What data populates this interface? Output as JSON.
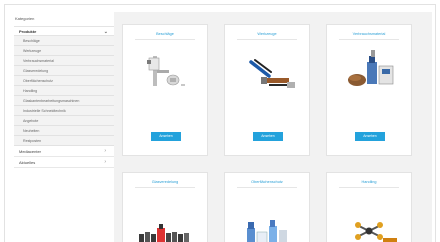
{
  "sidebar": {
    "heading": "Kategorien",
    "section": "Produkte",
    "items": [
      "Beschläge",
      "Werkzeuge",
      "Verbrauchsmaterial",
      "Glasveredelung",
      "Oberflächenschutz",
      "Handling",
      "Glaskantenbearbeitungsmaschinen",
      "Industrielle Schneidtechnik",
      "Angebote",
      "Neuheiten",
      "Restposten"
    ],
    "groups": [
      {
        "label": "Mediacenter"
      },
      {
        "label": "Aktuelles"
      }
    ]
  },
  "cards": [
    {
      "title": "Beschläge",
      "button": "Ansehen"
    },
    {
      "title": "Werkzeuge",
      "button": "Ansehen"
    },
    {
      "title": "Verbrauchsmaterial",
      "button": "Ansehen"
    },
    {
      "title": "Glasveredelung",
      "button": ""
    },
    {
      "title": "Oberflächenschutz",
      "button": ""
    },
    {
      "title": "Handling",
      "button": ""
    }
  ],
  "colors": {
    "accent": "#23a2dc",
    "title": "#2a9fd6",
    "panel": "#f2f2f2"
  }
}
